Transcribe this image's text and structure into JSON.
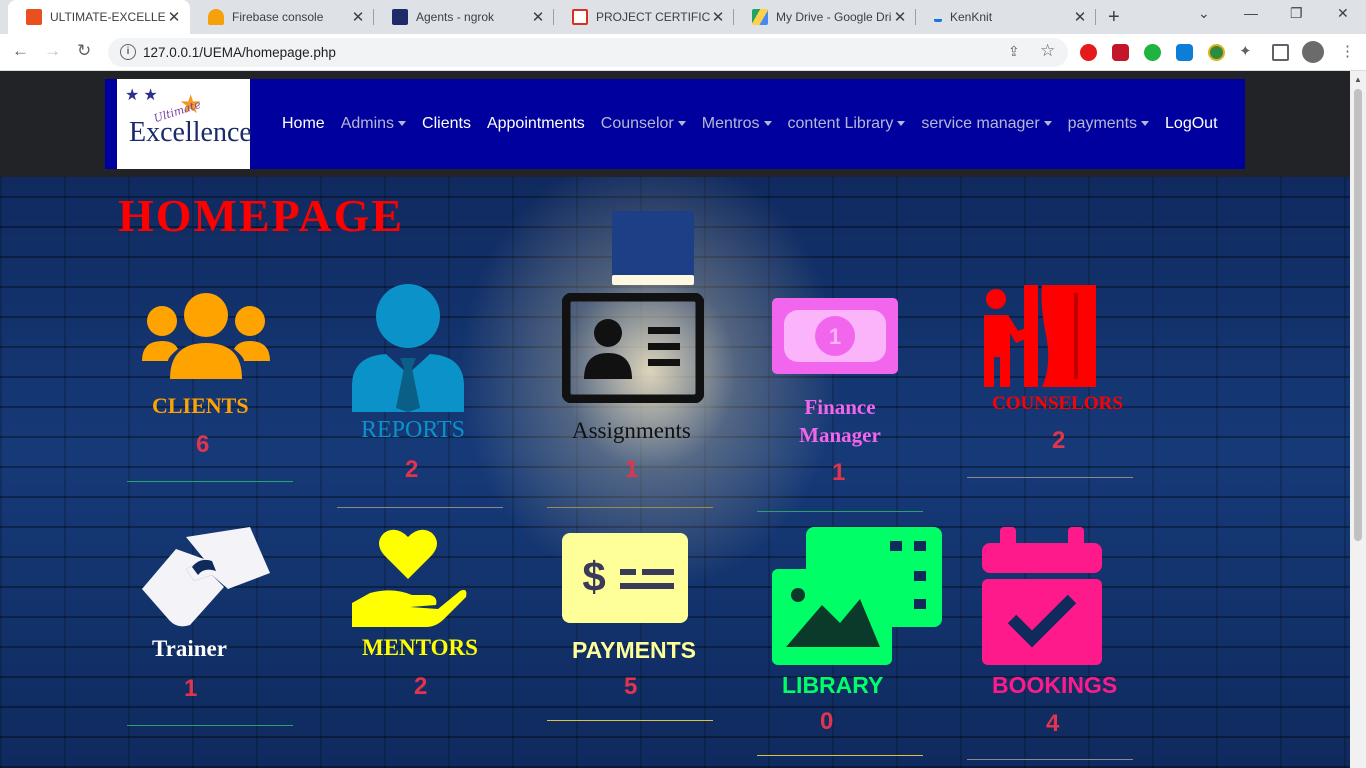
{
  "browser": {
    "tabs": [
      {
        "title": "ULTIMATE-EXCELLENC",
        "active": true,
        "favicon_color": "#e8501f"
      },
      {
        "title": "Firebase console",
        "active": false,
        "favicon_color": "#f6a00b"
      },
      {
        "title": "Agents - ngrok",
        "active": false,
        "favicon_color": "#1f2a6b"
      },
      {
        "title": "PROJECT CERTIFICATE",
        "active": false,
        "favicon_color": "#d93025"
      },
      {
        "title": "My Drive - Google Dri",
        "active": false,
        "favicon_color": "#1fa463"
      },
      {
        "title": "KenKnit",
        "active": false,
        "favicon_color": "#1a73e8"
      }
    ],
    "url": "127.0.0.1/UEMA/homepage.php"
  },
  "navbar": {
    "logo": {
      "line1": "Ultimate",
      "line2": "Excellence"
    },
    "links": [
      {
        "label": "Home",
        "dropdown": false,
        "dim": false
      },
      {
        "label": "Admins",
        "dropdown": true,
        "dim": true
      },
      {
        "label": "Clients",
        "dropdown": false,
        "dim": false
      },
      {
        "label": "Appointments",
        "dropdown": false,
        "dim": false
      },
      {
        "label": "Counselor",
        "dropdown": true,
        "dim": true
      },
      {
        "label": "Mentros",
        "dropdown": true,
        "dim": true
      },
      {
        "label": "content Library",
        "dropdown": true,
        "dim": true
      },
      {
        "label": "service manager",
        "dropdown": true,
        "dim": true
      },
      {
        "label": "payments",
        "dropdown": true,
        "dim": true
      },
      {
        "label": "LogOut",
        "dropdown": false,
        "dim": false
      }
    ]
  },
  "page": {
    "title": "HOMEPAGE",
    "cards": [
      {
        "id": "clients",
        "label": "CLIENTS",
        "count": "6",
        "color": "#ffa300",
        "icon": "users-icon"
      },
      {
        "id": "reports",
        "label": "REPORTS",
        "count": "2",
        "color": "#0b92c8",
        "icon": "user-tie-icon"
      },
      {
        "id": "assignments",
        "label": "Assignments",
        "count": "1",
        "color": "#111111",
        "icon": "id-card-icon"
      },
      {
        "id": "finance",
        "label": "Finance Manager",
        "count": "1",
        "color": "#f266ee",
        "icon": "money-bill-icon"
      },
      {
        "id": "counselors",
        "label": "COUNSELORS",
        "count": "2",
        "color": "#ff0000",
        "icon": "person-booth-icon"
      },
      {
        "id": "trainer",
        "label": "Trainer",
        "count": "1",
        "color": "#ffffff",
        "icon": "handshake-icon"
      },
      {
        "id": "mentors",
        "label": "MENTORS",
        "count": "2",
        "color": "#ffff00",
        "icon": "hand-holding-heart-icon"
      },
      {
        "id": "payments",
        "label": "PAYMENTS",
        "count": "5",
        "color": "#ffff99",
        "icon": "money-check-icon"
      },
      {
        "id": "library",
        "label": "LIBRARY",
        "count": "0",
        "color": "#00ff66",
        "icon": "photo-video-icon"
      },
      {
        "id": "bookings",
        "label": "BOOKINGS",
        "count": "4",
        "color": "#ff1a8c",
        "icon": "calendar-check-icon"
      }
    ]
  }
}
